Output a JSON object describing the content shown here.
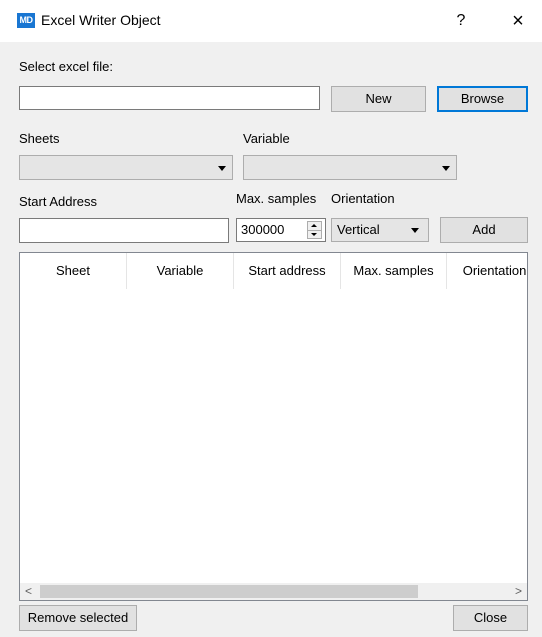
{
  "window": {
    "app_icon_text": "MD",
    "title": "Excel Writer Object",
    "help_label": "?",
    "close_label": "×"
  },
  "file": {
    "label": "Select excel file:",
    "value": "",
    "new_label": "New",
    "browse_label": "Browse"
  },
  "sheets": {
    "label": "Sheets",
    "selected": ""
  },
  "variable": {
    "label": "Variable",
    "selected": ""
  },
  "start_address": {
    "label": "Start Address",
    "value": ""
  },
  "max_samples": {
    "label": "Max. samples",
    "value": "300000"
  },
  "orientation": {
    "label": "Orientation",
    "selected": "Vertical"
  },
  "add_label": "Add",
  "table": {
    "columns": [
      "Sheet",
      "Variable",
      "Start address",
      "Max. samples",
      "Orientation"
    ],
    "rows": []
  },
  "footer": {
    "remove_label": "Remove selected",
    "close_label": "Close"
  },
  "icons": {
    "app": "excel-writer-app-icon",
    "help": "help-question-icon",
    "close": "close-icon",
    "dropdown": "chevron-down-icon",
    "spin_up": "spin-up-icon",
    "spin_down": "spin-down-icon",
    "scroll_left": "scroll-left-icon",
    "scroll_right": "scroll-right-icon"
  },
  "colors": {
    "accent": "#0078d7",
    "app_icon_bg": "#1976d2",
    "dialog_bg": "#f0f0f0"
  }
}
